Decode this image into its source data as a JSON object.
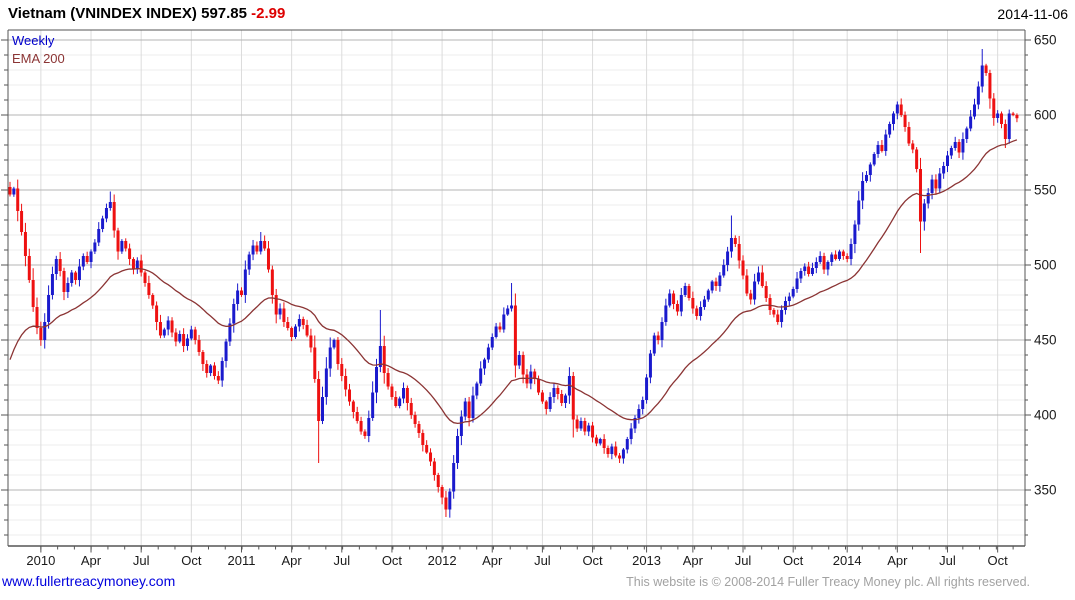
{
  "header": {
    "title": "Vietnam (VNINDEX INDEX) 597.85",
    "change": "-2.99",
    "date": "2014-11-06"
  },
  "legend": {
    "timeframe": "Weekly",
    "overlay": "EMA 200"
  },
  "footer": {
    "site_link": "www.fullertreacymoney.com",
    "copyright": "This website is © 2008-2014 Fuller Treacy Money plc. All rights reserved."
  },
  "colors": {
    "up": "#1a1acd",
    "down": "#ee1111",
    "ema": "#8b3434",
    "grid_minor": "#ededed",
    "grid_major": "#b5b5b5",
    "grid_vertical": "#dcdcdc",
    "axis": "#555555",
    "tick_text": "#1a1a1a",
    "change_text": "#dd0000",
    "legend_weekly": "#0000cc",
    "link": "#0000dd",
    "copyright_text": "#a2a2a2"
  },
  "chart_data": {
    "type": "candlestick",
    "title": "Vietnam (VNINDEX INDEX)",
    "timeframe": "weekly",
    "overlay": "EMA 200",
    "last_close": 597.85,
    "change": -2.99,
    "as_of": "2014-11-06",
    "y_axis": {
      "side": "right",
      "min": 350,
      "max": 650,
      "major_step": 50,
      "minor_step": 10,
      "ticks": [
        650,
        600,
        550,
        500,
        450,
        400,
        350
      ]
    },
    "x_axis": {
      "start": "2009-11-06",
      "end": "2014-11-06",
      "unit": "week",
      "ticks": [
        {
          "label": "2010",
          "week": 8
        },
        {
          "label": "Apr",
          "week": 21
        },
        {
          "label": "Jul",
          "week": 34
        },
        {
          "label": "Oct",
          "week": 47
        },
        {
          "label": "2011",
          "week": 60
        },
        {
          "label": "Apr",
          "week": 73
        },
        {
          "label": "Jul",
          "week": 86
        },
        {
          "label": "Oct",
          "week": 99
        },
        {
          "label": "2012",
          "week": 112
        },
        {
          "label": "Apr",
          "week": 125
        },
        {
          "label": "Jul",
          "week": 138
        },
        {
          "label": "Oct",
          "week": 151
        },
        {
          "label": "2013",
          "week": 165
        },
        {
          "label": "Apr",
          "week": 177
        },
        {
          "label": "Jul",
          "week": 190
        },
        {
          "label": "Oct",
          "week": 203
        },
        {
          "label": "2014",
          "week": 217
        },
        {
          "label": "Apr",
          "week": 230
        },
        {
          "label": "Jul",
          "week": 243
        },
        {
          "label": "Oct",
          "week": 256
        }
      ]
    },
    "series": [
      {
        "name": "VNINDEX weekly close (est. from chart)",
        "values": [
          547,
          551,
          536,
          522,
          506,
          490,
          472,
          458,
          450,
          462,
          480,
          494,
          504,
          496,
          482,
          488,
          495,
          490,
          499,
          506,
          502,
          509,
          515,
          524,
          531,
          538,
          542,
          523,
          509,
          516,
          511,
          504,
          497,
          503,
          495,
          488,
          480,
          473,
          462,
          453,
          457,
          463,
          455,
          449,
          454,
          446,
          451,
          457,
          450,
          442,
          434,
          428,
          433,
          426,
          423,
          436,
          449,
          461,
          474,
          483,
          480,
          497,
          507,
          513,
          509,
          516,
          511,
          497,
          480,
          467,
          471,
          462,
          458,
          452,
          459,
          464,
          460,
          453,
          445,
          424,
          396,
          412,
          431,
          445,
          450,
          434,
          426,
          417,
          409,
          402,
          396,
          389,
          386,
          398,
          415,
          432,
          446,
          428,
          419,
          412,
          406,
          411,
          418,
          408,
          400,
          394,
          388,
          380,
          375,
          369,
          360,
          352,
          345,
          337,
          349,
          368,
          386,
          399,
          409,
          398,
          413,
          421,
          431,
          437,
          445,
          452,
          459,
          457,
          467,
          471,
          473,
          433,
          440,
          427,
          421,
          429,
          424,
          415,
          409,
          404,
          412,
          418,
          414,
          408,
          413,
          426,
          397,
          391,
          396,
          389,
          393,
          385,
          381,
          384,
          378,
          374,
          379,
          373,
          371,
          377,
          384,
          391,
          398,
          404,
          410,
          425,
          441,
          453,
          450,
          462,
          473,
          481,
          474,
          469,
          480,
          486,
          478,
          471,
          466,
          472,
          477,
          483,
          489,
          486,
          493,
          500,
          509,
          518,
          514,
          503,
          493,
          481,
          477,
          489,
          495,
          486,
          478,
          470,
          467,
          462,
          470,
          476,
          479,
          484,
          491,
          496,
          499,
          494,
          498,
          502,
          506,
          497,
          502,
          507,
          504,
          509,
          506,
          504,
          514,
          527,
          543,
          556,
          560,
          567,
          574,
          580,
          576,
          587,
          594,
          601,
          607,
          600,
          592,
          581,
          577,
          564,
          529,
          541,
          548,
          557,
          551,
          561,
          566,
          573,
          578,
          582,
          575,
          584,
          591,
          599,
          607,
          619,
          633,
          628,
          611,
          598,
          601,
          594,
          584,
          601,
          600,
          597.85
        ],
        "extremes": {
          "26": {
            "high": 549
          },
          "65": {
            "high": 522
          },
          "80": {
            "low": 368
          },
          "96": {
            "high": 470
          },
          "113": {
            "low": 332
          },
          "130": {
            "high": 488
          },
          "146": {
            "low": 385
          },
          "187": {
            "high": 533
          },
          "230": {
            "high": 609
          },
          "236": {
            "low": 508
          },
          "252": {
            "high": 644
          },
          "258": {
            "low": 578
          }
        },
        "first_open": 552
      },
      {
        "name": "EMA 200",
        "derived": "ema",
        "period_weeks": 33,
        "seed": 430
      }
    ]
  }
}
